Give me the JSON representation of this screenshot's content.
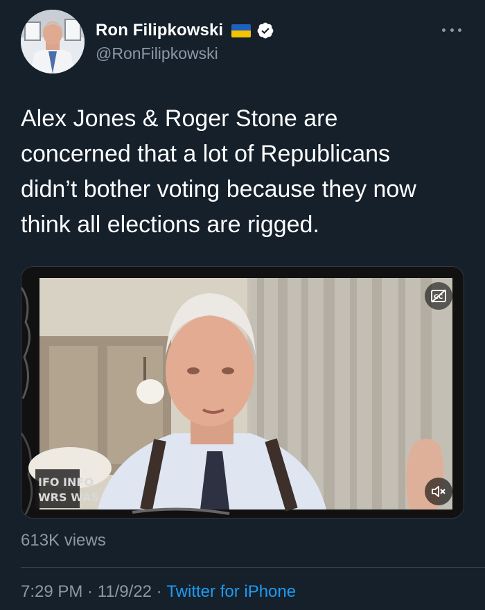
{
  "author": {
    "display_name": "Ron Filipkowski",
    "handle": "@RonFilipkowski",
    "flag_icon": "ukraine-flag-icon",
    "verified_icon": "verified-badge-icon",
    "flag_colors": [
      "#1f5fbf",
      "#f2c300"
    ],
    "verified_color": "#ffffff"
  },
  "tweet": {
    "text": "Alex Jones & Roger Stone are\nconcerned that a lot of Republicans\ndidn’t bother voting because they now\nthink all elections are rigged.",
    "views": "613K views",
    "time": "7:29 PM",
    "separator": " · ",
    "date": "11/9/22",
    "source": "Twitter for iPhone"
  },
  "media": {
    "watermark_text": "INFO INFO WARS WARS",
    "cc_icon": "closed-captions-off-icon",
    "mute_icon": "speaker-muted-icon"
  },
  "colors": {
    "background": "#15202b",
    "secondary_text": "#8b98a5",
    "link": "#1d9bf0"
  }
}
